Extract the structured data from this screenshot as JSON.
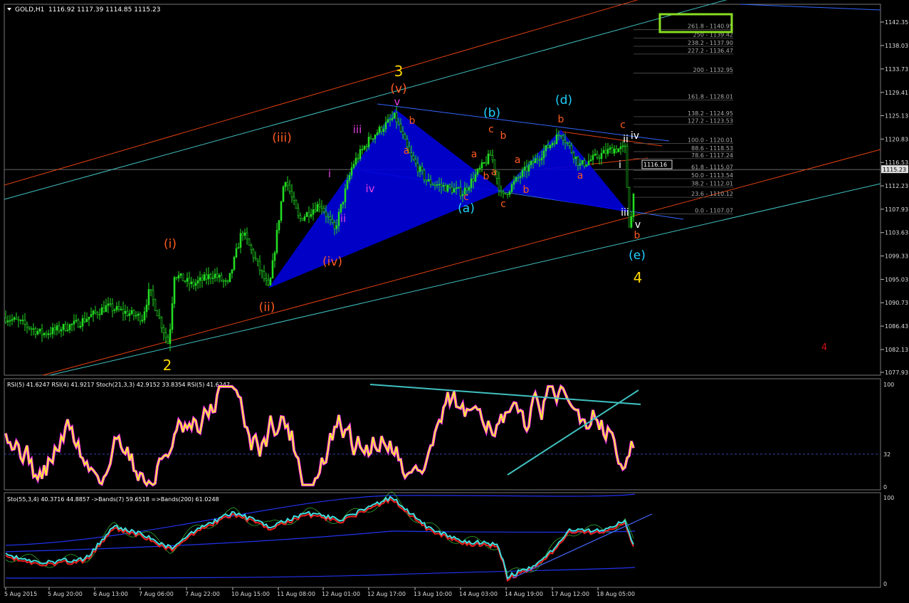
{
  "header": {
    "symbol_title": "GOLD,H1",
    "ohlc": "1116.92 1117.39 1114.85 1115.23",
    "current_price": "1115.23",
    "cursor_price": "1116.16"
  },
  "price_axis": {
    "labels": [
      "1142.35",
      "1138.03",
      "1133.73",
      "1129.41",
      "1125.13",
      "1120.83",
      "1116.53",
      "1112.23",
      "1107.93",
      "1103.63",
      "1099.33",
      "1095.03",
      "1090.73",
      "1086.43",
      "1082.13",
      "1077.93"
    ]
  },
  "time_axis": {
    "labels": [
      "5 Aug 2015",
      "5 Aug 20:00",
      "6 Aug 13:00",
      "7 Aug 06:00",
      "7 Aug 22:00",
      "10 Aug 15:00",
      "11 Aug 08:00",
      "12 Aug 01:00",
      "12 Aug 17:00",
      "13 Aug 10:00",
      "14 Aug 03:00",
      "14 Aug 19:00",
      "17 Aug 12:00",
      "18 Aug 05:00"
    ]
  },
  "fibonacci": {
    "levels": [
      "261.8 - 1140.95",
      "250 - 1139.42",
      "238.2 - 1137.90",
      "227.2 - 1136.47",
      "200 - 1132.95",
      "161.8 - 1128.01",
      "138.2 - 1124.95",
      "127.2 - 1123.53",
      "100.0 - 1120.01",
      "88.6 - 1118.53",
      "78.6 - 1117.24",
      "61.8 - 1115.07",
      "50.0 - 1113.54",
      "38.2 - 1112.01",
      "23.6 - 1110.12",
      "0.0 - 1107.07"
    ]
  },
  "wave_labels": {
    "major": [
      "2",
      "3",
      "4"
    ],
    "intermediate": [
      "(i)",
      "(ii)",
      "(iii)",
      "(iv)",
      "(v)"
    ],
    "minor": [
      "i",
      "ii",
      "iii",
      "iv",
      "v"
    ],
    "abc_corrective": [
      "(a)",
      "(b)",
      "(d)",
      "(e)"
    ],
    "subwaves_orange": [
      "a",
      "b",
      "c",
      "a",
      "b",
      "c",
      "a",
      "b",
      "a",
      "b",
      "c",
      "a",
      "b",
      "c",
      "b",
      "c"
    ],
    "late_minor": [
      "i",
      "ii",
      "iii",
      "iv",
      "v"
    ],
    "stray_red": "4"
  },
  "rsi_panel": {
    "legend": "RSI(5) 41.6247  RSI(4) 41.9217  Stoch(21,3,3) 42.9152 33.8354  RSI(5) 41.6247",
    "scale": [
      "100",
      "32",
      "0"
    ]
  },
  "sto_panel": {
    "legend": "Sto(55,3,4) 40.3716 44.8857  ->Bands(7) 59.6518  =>Bands(200) 61.0248",
    "scale": [
      "100",
      "0"
    ]
  },
  "colors": {
    "candle": "#22dd22",
    "pattern_fill": "#0000dd",
    "channel_cyan": "#40c0c0",
    "channel_orange": "#e04010",
    "label_orange": "#ff5a20",
    "label_yellow": "#ffd700",
    "label_cyan": "#20d0ff",
    "label_magenta": "#e040e0",
    "fib_box": "#88dd22"
  },
  "chart_data": {
    "type": "line",
    "title": "GOLD,H1",
    "ylim": [
      1077.93,
      1142.35
    ],
    "grid": false,
    "x": [
      "5 Aug 2015",
      "5 Aug 20:00",
      "6 Aug 13:00",
      "7 Aug 06:00",
      "7 Aug 22:00",
      "10 Aug 15:00",
      "11 Aug 08:00",
      "12 Aug 01:00",
      "12 Aug 17:00",
      "13 Aug 10:00",
      "14 Aug 03:00",
      "14 Aug 19:00",
      "17 Aug 12:00",
      "18 Aug 05:00"
    ],
    "series": [
      {
        "name": "GOLD,H1",
        "values": [
          1088.0,
          1087.0,
          1091.0,
          1090.0,
          1094.0,
          1101.0,
          1110.0,
          1110.0,
          1124.5,
          1114.0,
          1115.0,
          1113.5,
          1118.0,
          1115.2
        ]
      }
    ]
  }
}
